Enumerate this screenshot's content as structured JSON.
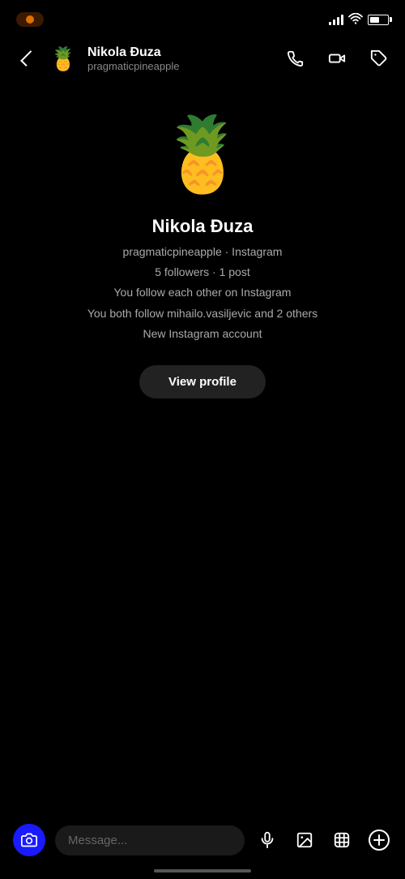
{
  "statusBar": {
    "pillLabel": "●",
    "batteryLevel": "55"
  },
  "header": {
    "backLabel": "‹",
    "avatarEmoji": "🍍",
    "name": "Nikola Đuza",
    "username": "pragmaticpineapple",
    "phoneLabel": "phone",
    "videoLabel": "video",
    "tagLabel": "tag"
  },
  "profile": {
    "avatarEmoji": "🍍",
    "name": "Nikola Đuza",
    "usernameLine": "pragmaticpineapple · Instagram",
    "followersLine": "5 followers · 1 post",
    "mutualLine": "You follow each other on Instagram",
    "mutualFollowLine": "You both follow mihailo.vasiljevic and 2 others",
    "accountAgeLine": "New Instagram account",
    "viewProfileLabel": "View profile"
  },
  "messageBar": {
    "placeholder": "Message...",
    "cameraIcon": "camera",
    "micIcon": "mic",
    "photoIcon": "photo",
    "stickerIcon": "sticker",
    "plusIcon": "plus"
  }
}
